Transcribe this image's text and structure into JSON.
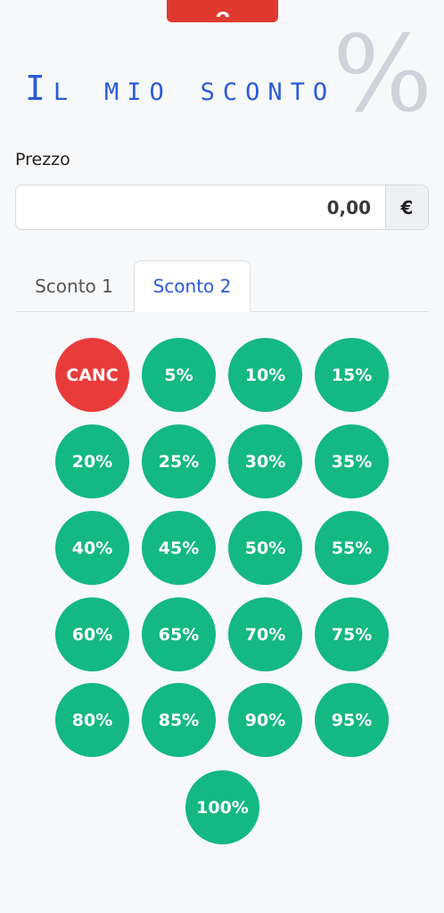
{
  "header": {
    "title": "Il mio sconto",
    "logo_symbol": "%"
  },
  "price": {
    "label": "Prezzo",
    "value": "0,00",
    "currency": "€"
  },
  "tabs": [
    {
      "label": "Sconto 1",
      "active": false
    },
    {
      "label": "Sconto 2",
      "active": true
    }
  ],
  "buttons": {
    "cancel": "CANC",
    "discounts": [
      "5%",
      "10%",
      "15%",
      "20%",
      "25%",
      "30%",
      "35%",
      "40%",
      "45%",
      "50%",
      "55%",
      "60%",
      "65%",
      "70%",
      "75%",
      "80%",
      "85%",
      "90%",
      "95%",
      "100%"
    ]
  },
  "colors": {
    "accent_green": "#14b882",
    "cancel_red": "#ea3b3b",
    "title_blue": "#2a5bd7",
    "top_tab_red": "#e03a2f"
  }
}
